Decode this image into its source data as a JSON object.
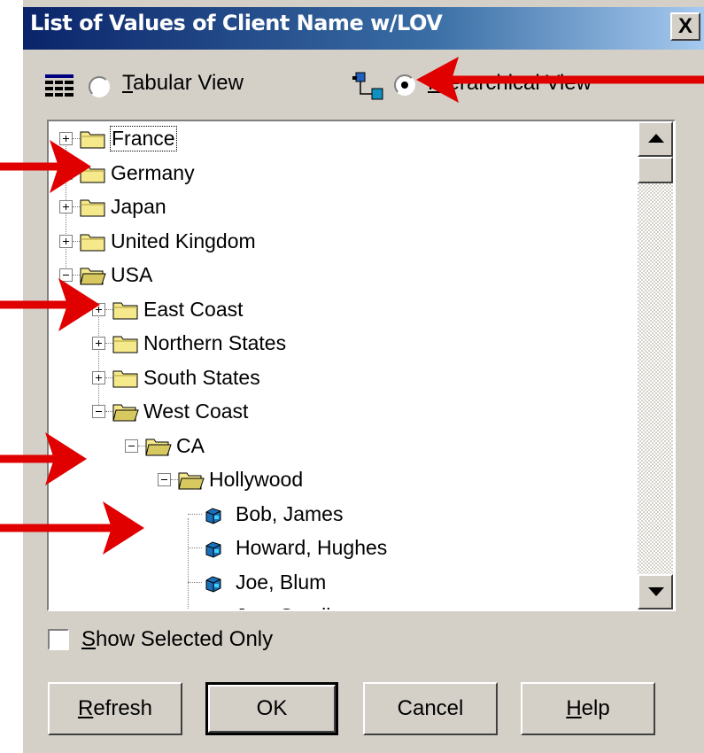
{
  "dialog": {
    "title": "List of Values of Client Name w/LOV",
    "close_label": "X"
  },
  "views": {
    "tabular_label": "Tabular View",
    "hierarchical_label": "Hierarchical View",
    "selected": "hierarchical"
  },
  "tree": [
    {
      "label": "France",
      "level": 0,
      "type": "folder",
      "expanded": false
    },
    {
      "label": "Germany",
      "level": 0,
      "type": "folder",
      "expanded": false
    },
    {
      "label": "Japan",
      "level": 0,
      "type": "folder",
      "expanded": false
    },
    {
      "label": "United Kingdom",
      "level": 0,
      "type": "folder",
      "expanded": false
    },
    {
      "label": "USA",
      "level": 0,
      "type": "folder",
      "expanded": true
    },
    {
      "label": "East Coast",
      "level": 1,
      "type": "folder",
      "expanded": false
    },
    {
      "label": "Northern States",
      "level": 1,
      "type": "folder",
      "expanded": false
    },
    {
      "label": "South States",
      "level": 1,
      "type": "folder",
      "expanded": false
    },
    {
      "label": "West Coast",
      "level": 1,
      "type": "folder",
      "expanded": true
    },
    {
      "label": "CA",
      "level": 2,
      "type": "folder",
      "expanded": true
    },
    {
      "label": "Hollywood",
      "level": 3,
      "type": "folder",
      "expanded": true
    },
    {
      "label": "Bob, James",
      "level": 4,
      "type": "leaf"
    },
    {
      "label": "Howard, Hughes",
      "level": 4,
      "type": "leaf"
    },
    {
      "label": "Joe, Blum",
      "level": 4,
      "type": "leaf"
    },
    {
      "label": "Joe, Small",
      "level": 4,
      "type": "leaf"
    }
  ],
  "options": {
    "show_selected_label": "Show Selected Only",
    "show_selected_checked": false
  },
  "buttons": {
    "refresh": "Refresh",
    "ok": "OK",
    "cancel": "Cancel",
    "help": "Help"
  },
  "colors": {
    "title_bar": "#0a246a",
    "dialog_bg": "#d4d0c8",
    "folder": "#f5e98b",
    "annotation_arrow": "#e00000"
  }
}
